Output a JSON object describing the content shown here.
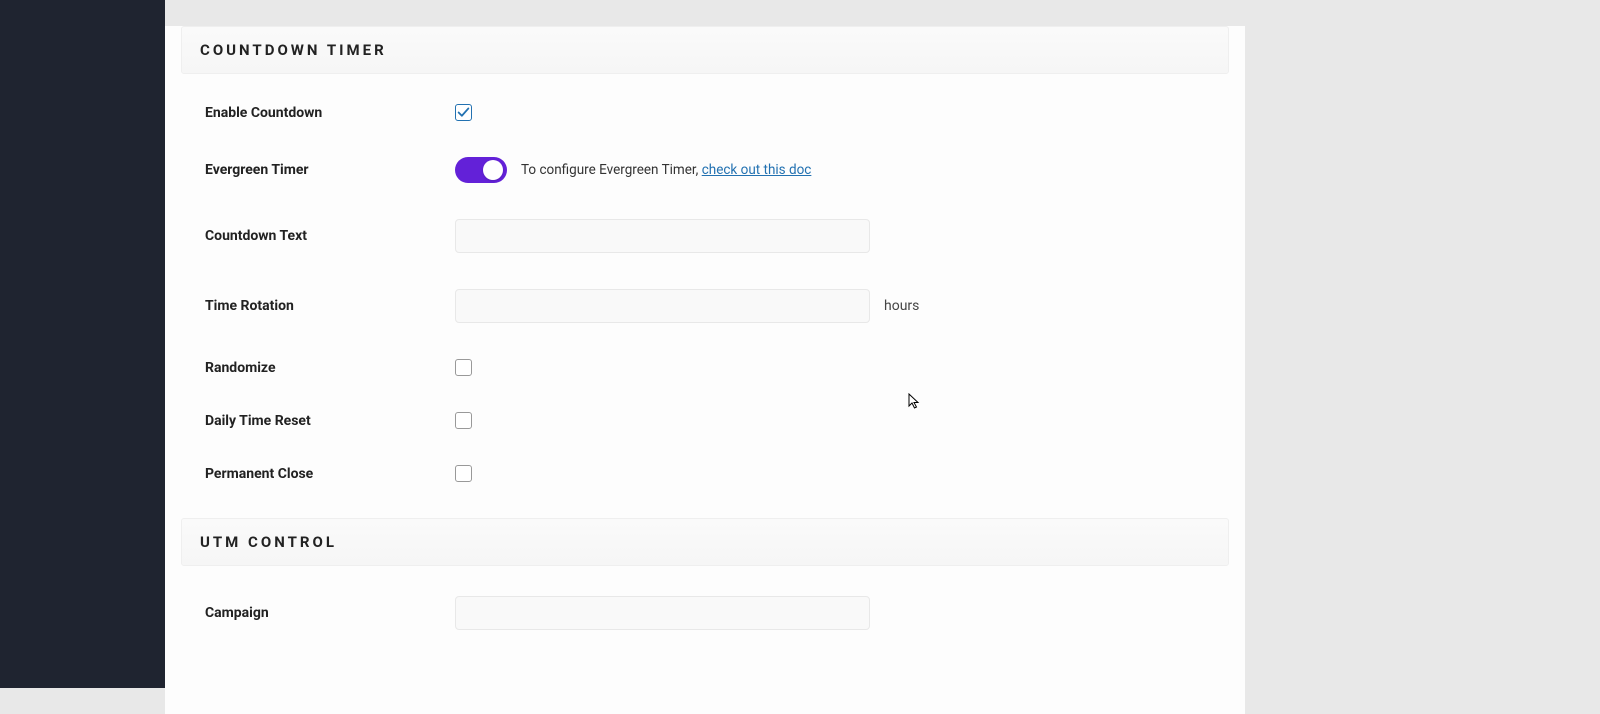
{
  "sections": {
    "countdown": {
      "title": "COUNTDOWN TIMER",
      "enable_label": "Enable Countdown",
      "enable_checked": true,
      "evergreen_label": "Evergreen Timer",
      "evergreen_on": true,
      "evergreen_help_prefix": "To configure Evergreen Timer, ",
      "evergreen_help_link": "check out this doc",
      "text_label": "Countdown Text",
      "text_value": "",
      "rotation_label": "Time Rotation",
      "rotation_value": "",
      "rotation_suffix": "hours",
      "randomize_label": "Randomize",
      "randomize_checked": false,
      "daily_reset_label": "Daily Time Reset",
      "daily_reset_checked": false,
      "permanent_close_label": "Permanent Close",
      "permanent_close_checked": false
    },
    "utm": {
      "title": "UTM CONTROL",
      "campaign_label": "Campaign",
      "campaign_value": ""
    }
  }
}
